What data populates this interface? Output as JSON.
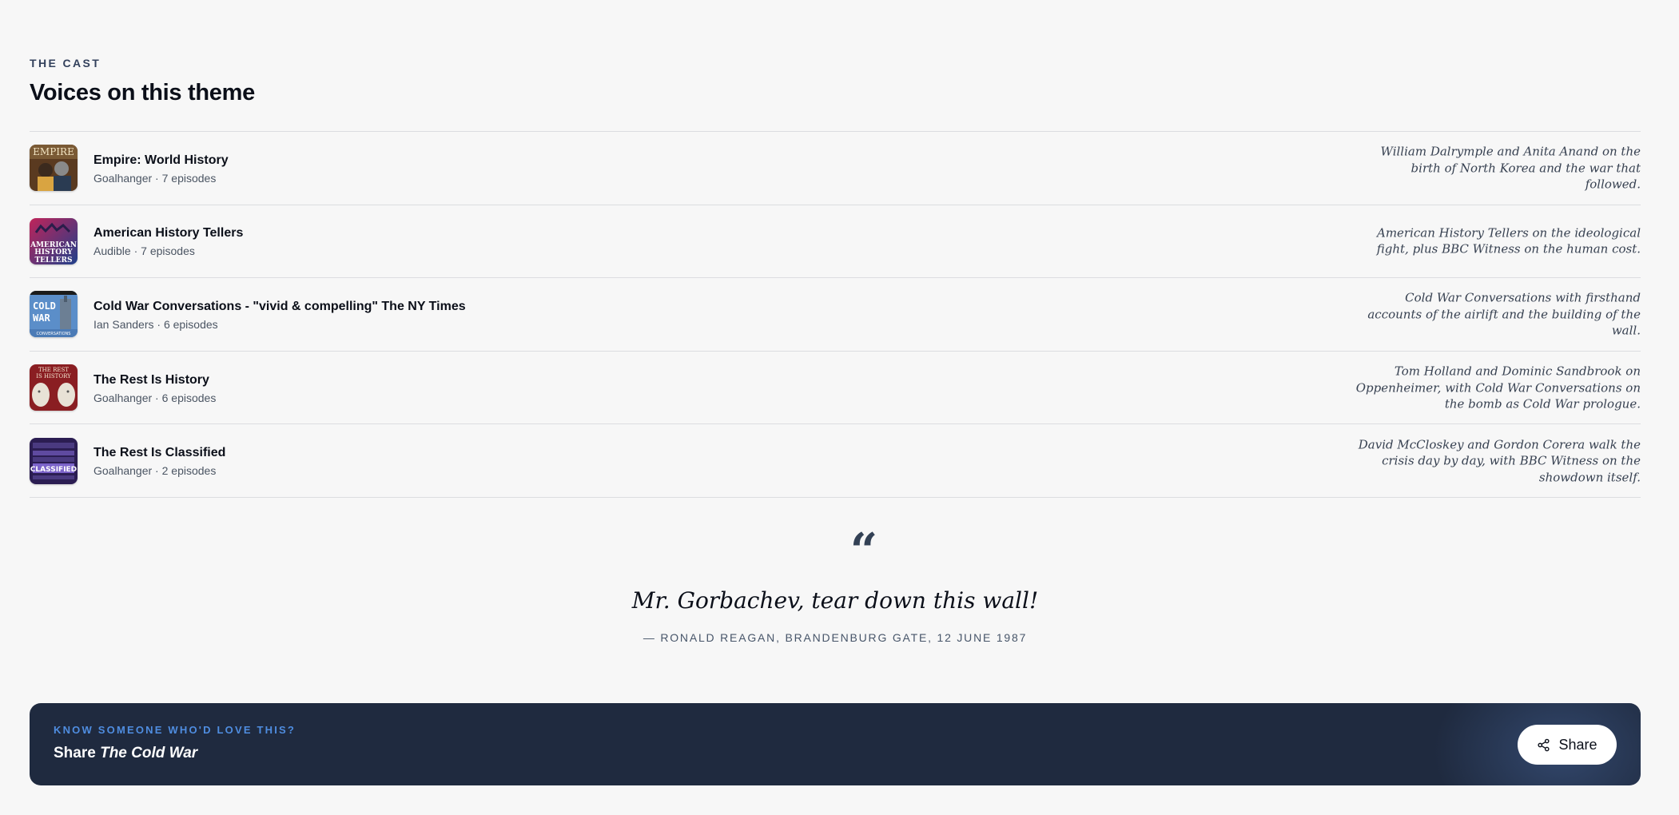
{
  "section": {
    "eyebrow": "THE CAST",
    "heading": "Voices on this theme"
  },
  "podcasts": [
    {
      "title": "Empire: World History",
      "publisher": "Goalhanger",
      "episodes": "7 episodes",
      "subline": "Goalhanger · 7 episodes",
      "art_label": "EMPIRE",
      "blurb": "William Dalrymple and Anita Anand on the birth of North Korea and the war that followed."
    },
    {
      "title": "American History Tellers",
      "publisher": "Audible",
      "episodes": "7 episodes",
      "subline": "Audible · 7 episodes",
      "art_label": "AMERICAN HISTORY TELLERS",
      "blurb": "American History Tellers on the ideological fight, plus BBC Witness on the human cost."
    },
    {
      "title": "Cold War Conversations - \"vivid & compelling\" The NY Times",
      "publisher": "Ian Sanders",
      "episodes": "6 episodes",
      "subline": "Ian Sanders · 6 episodes",
      "art_label": "COLD WAR CONVERSATIONS",
      "blurb": "Cold War Conversations with firsthand accounts of the airlift and the building of the wall."
    },
    {
      "title": "The Rest Is History",
      "publisher": "Goalhanger",
      "episodes": "6 episodes",
      "subline": "Goalhanger · 6 episodes",
      "art_label": "THE REST IS HISTORY",
      "blurb": "Tom Holland and Dominic Sandbrook on Oppenheimer, with Cold War Conversations on the bomb as Cold War prologue."
    },
    {
      "title": "The Rest Is Classified",
      "publisher": "Goalhanger",
      "episodes": "2 episodes",
      "subline": "Goalhanger · 2 episodes",
      "art_label": "CLASSIFIED",
      "blurb": "David McCloskey and Gordon Corera walk the crisis day by day, with BBC Witness on the showdown itself."
    }
  ],
  "quote": {
    "mark": "“",
    "text": "Mr. Gorbachev, tear down this wall!",
    "attribution": "— RONALD REAGAN, BRANDENBURG GATE, 12 JUNE 1987"
  },
  "share_banner": {
    "eyebrow": "KNOW SOMEONE WHO'D LOVE THIS?",
    "title_prefix": "Share ",
    "title_emphasis": "The Cold War",
    "button_label": "Share",
    "button_icon": "share-icon"
  },
  "colors": {
    "page_bg": "#f7f7f7",
    "banner_bg": "#1f2a3f",
    "banner_accent": "#4f8de0",
    "eyebrow": "#33415c"
  }
}
